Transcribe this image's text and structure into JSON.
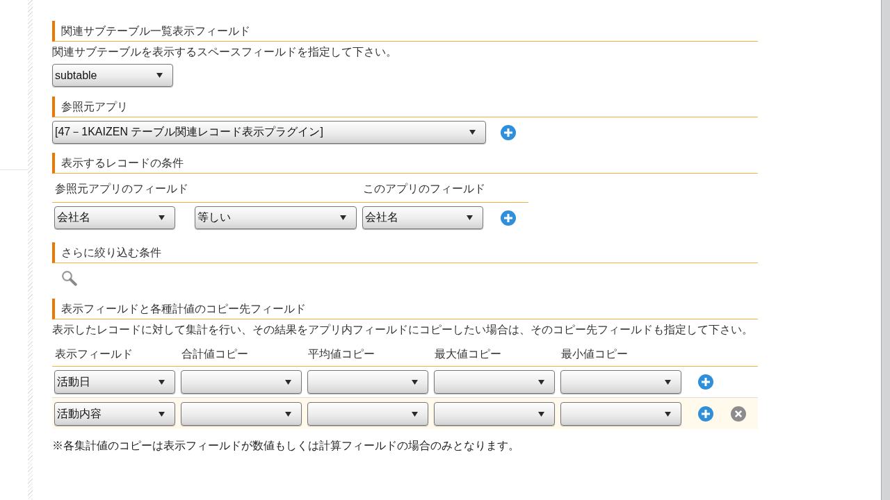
{
  "sections": [
    {
      "kind": "space_field",
      "title": "関連サブテーブル一覧表示フィールド",
      "description": "関連サブテーブルを表示するスペースフィールドを指定して下さい。",
      "dropdown": {
        "value": "subtable"
      }
    },
    {
      "kind": "source_app",
      "title": "参照元アプリ",
      "dropdown": {
        "value": "[47－1KAIZEN テーブル関連レコード表示プラグイン]"
      }
    },
    {
      "kind": "conditions",
      "title": "表示するレコードの条件",
      "columns": [
        "参照元アプリのフィールド",
        "このアプリのフィールド"
      ],
      "rows": [
        {
          "source_field": "会社名",
          "operator": "等しい",
          "target_field": "会社名"
        }
      ]
    },
    {
      "kind": "filter",
      "title": "さらに絞り込む条件"
    },
    {
      "kind": "copy_fields",
      "title": "表示フィールドと各種計値のコピー先フィールド",
      "description": "表示したレコードに対して集計を行い、その結果をアプリ内フィールドにコピーしたい場合は、そのコピー先フィールドも指定して下さい。",
      "columns": [
        "表示フィールド",
        "合計値コピー",
        "平均値コピー",
        "最大値コピー",
        "最小値コピー"
      ],
      "rows": [
        {
          "display_field": "活動日",
          "highlighted": false,
          "removable": false
        },
        {
          "display_field": "活動内容",
          "highlighted": true,
          "removable": true
        }
      ],
      "note": "※各集計値のコピーは表示フィールドが数値もしくは計算フィールドの場合のみとなります。"
    }
  ]
}
